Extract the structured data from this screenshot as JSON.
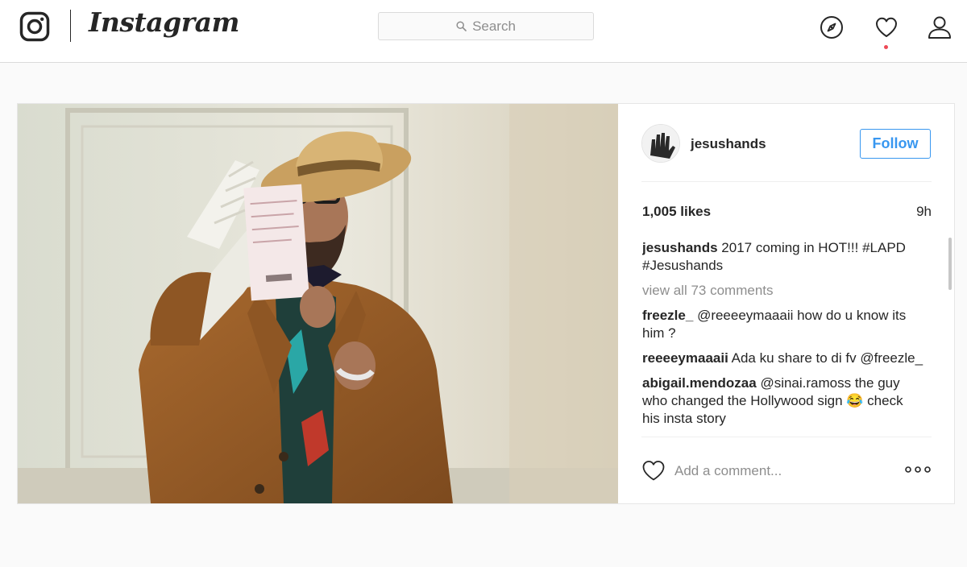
{
  "header": {
    "wordmark": "Instagram",
    "search_placeholder": "Search",
    "icons": [
      "instagram-camera-icon",
      "compass-icon",
      "heart-icon",
      "profile-icon",
      "search-icon"
    ],
    "notification_dot_color": "#ed4956"
  },
  "post": {
    "photo": {
      "icon": "post-photo"
    },
    "author": {
      "username": "jesushands"
    },
    "follow_label": "Follow",
    "likes": "1,005 likes",
    "time_ago": "9h",
    "caption": {
      "user": "jesushands",
      "text": "2017 coming in HOT!!! #LAPD #Jesushands"
    },
    "view_all_comments": "view all 73 comments",
    "comments": [
      {
        "user": "freezle_",
        "text": "@reeeeymaaaii how do u know its him ?"
      },
      {
        "user": "reeeeymaaaii",
        "text": "Ada ku share to di fv @freezle_"
      },
      {
        "user": "abigail.mendozaa",
        "text": "@sinai.ramoss the guy who changed the Hollywood sign 😂 check his insta story"
      }
    ],
    "add_comment_placeholder": "Add a comment...",
    "more_icon": "more-options-icon"
  },
  "colors": {
    "accent_blue": "#3897f0",
    "border": "#dbdbdb",
    "background": "#fafafa",
    "muted_text": "#8e8e8e"
  }
}
